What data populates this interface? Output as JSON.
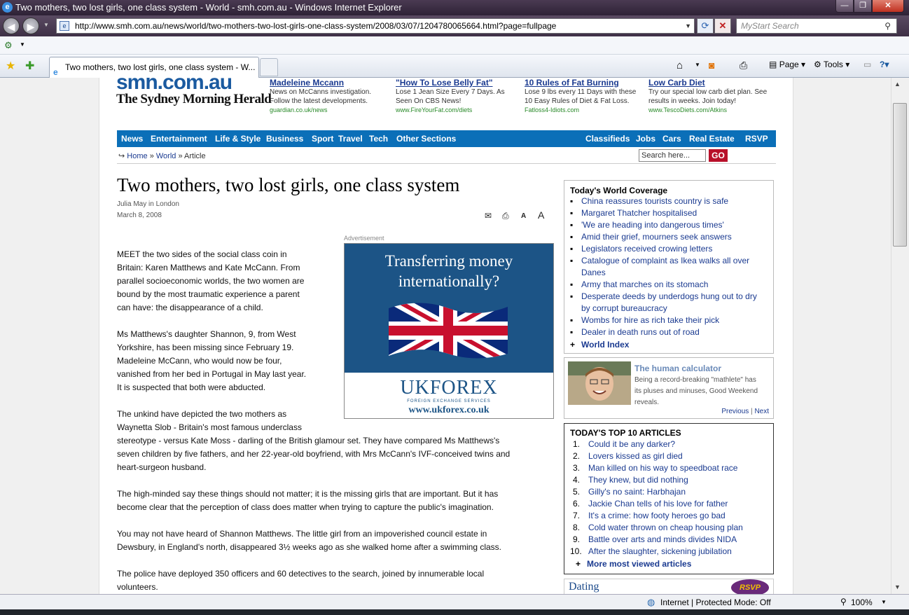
{
  "window": {
    "title": "Two mothers, two lost girls, one class system - World - smh.com.au - Windows Internet Explorer",
    "minimize": "—",
    "maximize": "❐",
    "close": "✕"
  },
  "addressbar": {
    "url": "http://www.smh.com.au/news/world/two-mothers-two-lost-girls-one-class-system/2008/03/07/1204780065664.html?page=fullpage",
    "search_placeholder": "MyStart Search"
  },
  "tab": {
    "label": "Two mothers, two lost girls, one class system - W..."
  },
  "commandbar": {
    "page": "Page ▾",
    "tools": "Tools ▾"
  },
  "site": {
    "logo_top": "smh.com.au",
    "logo_bottom": "The Sydney Morning Herald"
  },
  "ads_top": [
    {
      "headline": "Madeleine Mccann",
      "text": "News on McCanns investigation. Follow the latest developments.",
      "url": "guardian.co.uk/news"
    },
    {
      "headline": "\"How To Lose Belly Fat\"",
      "text": "Lose 1 Jean Size Every 7 Days. As Seen On CBS News!",
      "url": "www.FireYourFat.com/diets"
    },
    {
      "headline": "10 Rules of Fat Burning",
      "text": "Lose 9 lbs every 11 Days with these 10 Easy Rules of Diet & Fat Loss.",
      "url": "Fatloss4-Idiots.com"
    },
    {
      "headline": "Low Carb Diet",
      "text": "Try our special low carb diet plan. See results in weeks. Join today!",
      "url": "www.TescoDiets.com/Atkins"
    }
  ],
  "nav": {
    "left": [
      "News",
      "Entertainment",
      "Life & Style",
      "Business",
      "Sport",
      "Travel",
      "Tech",
      "Other Sections"
    ],
    "right": [
      "Classifieds",
      "Jobs",
      "Cars",
      "Real Estate",
      "RSVP"
    ]
  },
  "breadcrumb": {
    "arrow": "↪",
    "home": "Home",
    "sep": "»",
    "section": "World",
    "current": "Article"
  },
  "site_search": {
    "placeholder": "Search here...",
    "go": "GO"
  },
  "article": {
    "headline": "Two mothers, two lost girls, one class system",
    "byline": "Julia May in London",
    "date": "March 8, 2008",
    "paragraphs": [
      [
        "MEET the two sides of the social class coin in",
        "Britain: Karen Matthews and Kate McCann. From",
        "parallel socioeconomic worlds, the two women are",
        "bound by the most traumatic experience a parent",
        "can have: the disappearance of a child."
      ],
      [
        "Ms Matthews's daughter Shannon, 9, from West",
        "Yorkshire, has been missing since February 19.",
        "Madeleine McCann, who would now be four,",
        "vanished from her bed in Portugal in May last year.",
        "It is suspected that both were abducted."
      ],
      [
        "The unkind have depicted the two mothers as",
        "Waynetta Slob - Britain's most famous underclass",
        "stereotype - versus Kate Moss - darling of the British glamour set. They have compared Ms Matthews's",
        "seven children by five fathers, and her 22-year-old boyfriend, with Mrs McCann's IVF-conceived twins and",
        "heart-surgeon husband."
      ],
      [
        "The high-minded say these things should not matter; it is the missing girls that are important. But it has",
        "become clear that the perception of class does matter when trying to capture the public's imagination."
      ],
      [
        "You may not have heard of Shannon Matthews. The little girl from an impoverished council estate in",
        "Dewsbury, in England's north, disappeared 3½ weeks ago as she walked home after a swimming class."
      ],
      [
        "The police have deployed 350 officers and 60 detectives to the search, joined by innumerable local",
        "volunteers."
      ]
    ]
  },
  "advert": {
    "label": "Advertisement",
    "line1": "Transferring money",
    "line2": "internationally?",
    "brand": "UKFOREX",
    "tagline": "FOREIGN EXCHANGE SERVICES",
    "web": "www.ukforex.co.uk"
  },
  "world_coverage": {
    "title": "Today's World Coverage",
    "items": [
      [
        "China reassures tourists country is safe"
      ],
      [
        "Margaret Thatcher hospitalised"
      ],
      [
        "'We are heading into dangerous times'"
      ],
      [
        "Amid their grief, mourners seek answers"
      ],
      [
        "Legislators received crowing letters"
      ],
      [
        "Catalogue of complaint as Ikea walks all over",
        "Danes"
      ],
      [
        "Army that marches on its stomach"
      ],
      [
        "Desperate deeds by underdogs hung out to dry",
        "by corrupt bureaucracy"
      ],
      [
        "Wombs for hire as rich take their pick"
      ],
      [
        "Dealer in death runs out of road"
      ]
    ],
    "index": "World Index"
  },
  "feature": {
    "title": "The human calculator",
    "text": [
      "Being a record-breaking \"mathlete\" has",
      "its pluses and minuses, Good Weekend",
      "reveals."
    ],
    "previous": "Previous",
    "sep": "|",
    "next": "Next"
  },
  "top10": {
    "title": "TODAY'S TOP 10 ARTICLES",
    "items": [
      "Could it be any darker?",
      "Lovers kissed as girl died",
      "Man killed on his way to speedboat race",
      "They knew, but did nothing",
      "Gilly's no saint: Harbhajan",
      "Jackie Chan tells of his love for father",
      "It's a crime: how footy heroes go bad",
      "Cold water thrown on cheap housing plan",
      "Battle over arts and minds divides NIDA",
      "After the slaughter, sickening jubilation"
    ],
    "more": "More most viewed articles"
  },
  "dating": {
    "label": "Dating",
    "badge": "RSVP"
  },
  "status": {
    "zone": "Internet | Protected Mode: Off",
    "zoom": "100%"
  },
  "colors": {
    "nav_blue": "#0b6fb8",
    "link": "#1a3a90",
    "go_red": "#b8102a",
    "titlebar": "#3a2c42"
  }
}
